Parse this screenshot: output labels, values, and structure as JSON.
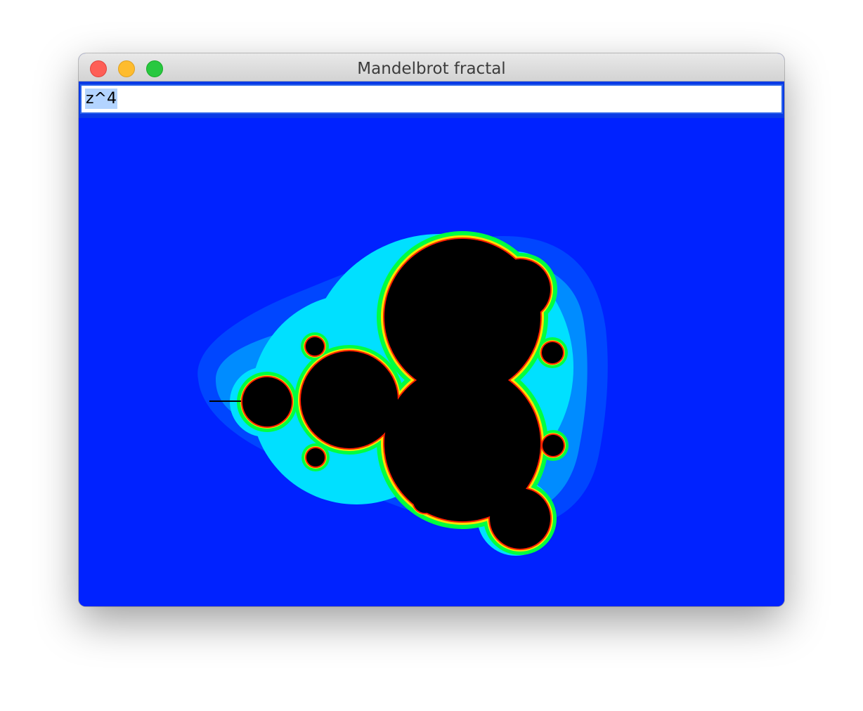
{
  "window": {
    "title": "Mandelbrot fractal"
  },
  "expression_field": {
    "value": "z^4"
  },
  "fractal": {
    "exponent": 4,
    "colors": {
      "background": "#0022ff",
      "band_outer": "#0046ff",
      "band_middle": "#008cff",
      "band_inner": "#00e0ff",
      "edge_green": "#00ff40",
      "edge_yellow": "#ffe000",
      "edge_red": "#ff2000",
      "set": "#000000"
    }
  }
}
